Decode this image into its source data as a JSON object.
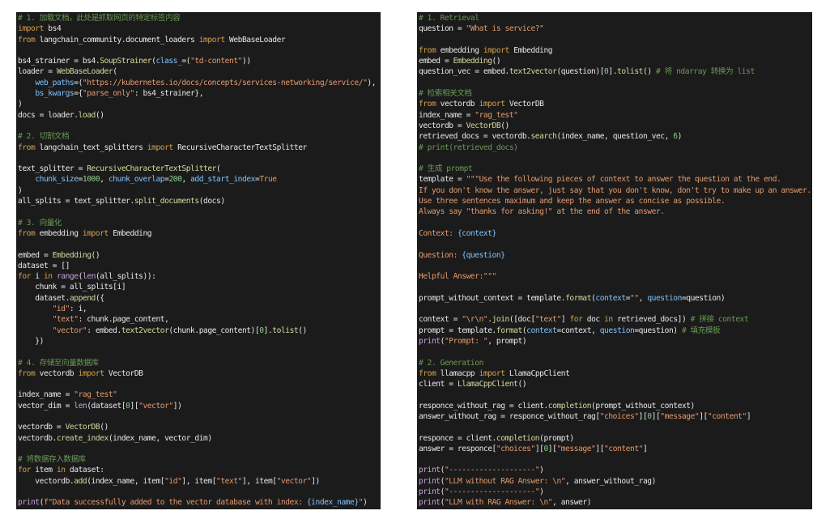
{
  "colors": {
    "background": "#ffffff",
    "editor_bg": "#1b1b1b",
    "comment": "#6a9955",
    "keyword": "#d5a04b",
    "string": "#e39b6e",
    "number": "#8fd08a",
    "function": "#d8d8a0",
    "builtin": "#c9a0dc",
    "param": "#7fc4ff",
    "text": "#dcdcdc"
  },
  "left_panel": {
    "lines": [
      [
        [
          "cm",
          "# 1. 加载文档，此处是抓取网页的特定标签内容"
        ]
      ],
      [
        [
          "kw",
          "import"
        ],
        [
          "id",
          " bs4"
        ]
      ],
      [
        [
          "kw",
          "from"
        ],
        [
          "id",
          " langchain_community.document_loaders "
        ],
        [
          "kw",
          "import"
        ],
        [
          "id",
          " WebBaseLoader"
        ]
      ],
      [],
      [
        [
          "id",
          "bs4_strainer = bs4."
        ],
        [
          "fn",
          "SoupStrainer"
        ],
        [
          "id",
          "("
        ],
        [
          "pm",
          "class_"
        ],
        [
          "id",
          "=("
        ],
        [
          "st",
          "\"td-content\""
        ],
        [
          "id",
          "))"
        ]
      ],
      [
        [
          "id",
          "loader = "
        ],
        [
          "fn",
          "WebBaseLoader"
        ],
        [
          "id",
          "("
        ]
      ],
      [
        [
          "id",
          "    "
        ],
        [
          "pm",
          "web_paths"
        ],
        [
          "id",
          "=("
        ],
        [
          "st",
          "\"https://kubernetes.io/docs/concepts/services-networking/service/\""
        ],
        [
          "id",
          "),"
        ]
      ],
      [
        [
          "id",
          "    "
        ],
        [
          "pm",
          "bs_kwargs"
        ],
        [
          "id",
          "={"
        ],
        [
          "st",
          "\"parse_only\""
        ],
        [
          "id",
          ": bs4_strainer},"
        ]
      ],
      [
        [
          "id",
          ")"
        ]
      ],
      [
        [
          "id",
          "docs = loader."
        ],
        [
          "fn",
          "load"
        ],
        [
          "id",
          "()"
        ]
      ],
      [],
      [
        [
          "cm",
          "# 2. 切割文档"
        ]
      ],
      [
        [
          "kw",
          "from"
        ],
        [
          "id",
          " langchain_text_splitters "
        ],
        [
          "kw",
          "import"
        ],
        [
          "id",
          " RecursiveCharacterTextSplitter"
        ]
      ],
      [],
      [
        [
          "id",
          "text_splitter = "
        ],
        [
          "fn",
          "RecursiveCharacterTextSplitter"
        ],
        [
          "id",
          "("
        ]
      ],
      [
        [
          "id",
          "    "
        ],
        [
          "pm",
          "chunk_size"
        ],
        [
          "id",
          "="
        ],
        [
          "nm",
          "1000"
        ],
        [
          "id",
          ", "
        ],
        [
          "pm",
          "chunk_overlap"
        ],
        [
          "id",
          "="
        ],
        [
          "nm",
          "200"
        ],
        [
          "id",
          ", "
        ],
        [
          "pm",
          "add_start_index"
        ],
        [
          "id",
          "="
        ],
        [
          "kw",
          "True"
        ]
      ],
      [
        [
          "id",
          ")"
        ]
      ],
      [
        [
          "id",
          "all_splits = text_splitter."
        ],
        [
          "fn",
          "split_documents"
        ],
        [
          "id",
          "(docs)"
        ]
      ],
      [],
      [
        [
          "cm",
          "# 3. 向量化"
        ]
      ],
      [
        [
          "kw",
          "from"
        ],
        [
          "id",
          " embedding "
        ],
        [
          "kw",
          "import"
        ],
        [
          "id",
          " Embedding"
        ]
      ],
      [],
      [
        [
          "id",
          "embed = "
        ],
        [
          "fn",
          "Embedding"
        ],
        [
          "id",
          "()"
        ]
      ],
      [
        [
          "id",
          "dataset = []"
        ]
      ],
      [
        [
          "kw",
          "for"
        ],
        [
          "id",
          " i "
        ],
        [
          "kw",
          "in"
        ],
        [
          "id",
          " "
        ],
        [
          "bi",
          "range"
        ],
        [
          "id",
          "("
        ],
        [
          "bi",
          "len"
        ],
        [
          "id",
          "(all_splits)):"
        ]
      ],
      [
        [
          "id",
          "    chunk = all_splits[i]"
        ]
      ],
      [
        [
          "id",
          "    dataset."
        ],
        [
          "fn",
          "append"
        ],
        [
          "id",
          "({"
        ]
      ],
      [
        [
          "id",
          "        "
        ],
        [
          "st",
          "\"id\""
        ],
        [
          "id",
          ": i,"
        ]
      ],
      [
        [
          "id",
          "        "
        ],
        [
          "st",
          "\"text\""
        ],
        [
          "id",
          ": chunk.page_content,"
        ]
      ],
      [
        [
          "id",
          "        "
        ],
        [
          "st",
          "\"vector\""
        ],
        [
          "id",
          ": embed."
        ],
        [
          "fn",
          "text2vector"
        ],
        [
          "id",
          "(chunk.page_content)["
        ],
        [
          "nm",
          "0"
        ],
        [
          "id",
          "]."
        ],
        [
          "fn",
          "tolist"
        ],
        [
          "id",
          "()"
        ]
      ],
      [
        [
          "id",
          "    })"
        ]
      ],
      [],
      [
        [
          "cm",
          "# 4. 存储至向量数据库"
        ]
      ],
      [
        [
          "kw",
          "from"
        ],
        [
          "id",
          " vectordb "
        ],
        [
          "kw",
          "import"
        ],
        [
          "id",
          " VectorDB"
        ]
      ],
      [],
      [
        [
          "id",
          "index_name = "
        ],
        [
          "st",
          "\"rag_test\""
        ]
      ],
      [
        [
          "id",
          "vector_dim = "
        ],
        [
          "bi",
          "len"
        ],
        [
          "id",
          "(dataset["
        ],
        [
          "nm",
          "0"
        ],
        [
          "id",
          "]["
        ],
        [
          "st",
          "\"vector\""
        ],
        [
          "id",
          "])"
        ]
      ],
      [],
      [
        [
          "id",
          "vectordb = "
        ],
        [
          "fn",
          "VectorDB"
        ],
        [
          "id",
          "()"
        ]
      ],
      [
        [
          "id",
          "vectordb."
        ],
        [
          "fn",
          "create_index"
        ],
        [
          "id",
          "(index_name, vector_dim)"
        ]
      ],
      [],
      [
        [
          "cm",
          "# 将数据存入数据库"
        ]
      ],
      [
        [
          "kw",
          "for"
        ],
        [
          "id",
          " item "
        ],
        [
          "kw",
          "in"
        ],
        [
          "id",
          " dataset:"
        ]
      ],
      [
        [
          "id",
          "    vectordb."
        ],
        [
          "fn",
          "add"
        ],
        [
          "id",
          "(index_name, item["
        ],
        [
          "st",
          "\"id\""
        ],
        [
          "id",
          "], item["
        ],
        [
          "st",
          "\"text\""
        ],
        [
          "id",
          "], item["
        ],
        [
          "st",
          "\"vector\""
        ],
        [
          "id",
          "])"
        ]
      ],
      [],
      [
        [
          "bi",
          "print"
        ],
        [
          "id",
          "("
        ],
        [
          "st",
          "f\"Data successfully added to the vector database with index: "
        ],
        [
          "pm",
          "{index_name}"
        ],
        [
          "st",
          "\""
        ],
        [
          "id",
          ")"
        ]
      ]
    ]
  },
  "right_panel": {
    "lines": [
      [
        [
          "cm",
          "# 1. Retrieval"
        ]
      ],
      [
        [
          "id",
          "question = "
        ],
        [
          "st",
          "\"What is service?\""
        ]
      ],
      [],
      [
        [
          "kw",
          "from"
        ],
        [
          "id",
          " embedding "
        ],
        [
          "kw",
          "import"
        ],
        [
          "id",
          " Embedding"
        ]
      ],
      [
        [
          "id",
          "embed = "
        ],
        [
          "fn",
          "Embedding"
        ],
        [
          "id",
          "()"
        ]
      ],
      [
        [
          "id",
          "question_vec = embed."
        ],
        [
          "fn",
          "text2vector"
        ],
        [
          "id",
          "(question)["
        ],
        [
          "nm",
          "0"
        ],
        [
          "id",
          "]."
        ],
        [
          "fn",
          "tolist"
        ],
        [
          "id",
          "() "
        ],
        [
          "cm",
          "# 将 ndarray 转换为 list"
        ]
      ],
      [],
      [
        [
          "cm",
          "# 检索相关文档"
        ]
      ],
      [
        [
          "kw",
          "from"
        ],
        [
          "id",
          " vectordb "
        ],
        [
          "kw",
          "import"
        ],
        [
          "id",
          " VectorDB"
        ]
      ],
      [
        [
          "id",
          "index_name = "
        ],
        [
          "st",
          "\"rag_test\""
        ]
      ],
      [
        [
          "id",
          "vectordb = "
        ],
        [
          "fn",
          "VectorDB"
        ],
        [
          "id",
          "()"
        ]
      ],
      [
        [
          "id",
          "retrieved_docs = vectordb."
        ],
        [
          "fn",
          "search"
        ],
        [
          "id",
          "(index_name, question_vec, "
        ],
        [
          "nm",
          "6"
        ],
        [
          "id",
          ")"
        ]
      ],
      [
        [
          "cm",
          "# print(retrieved_docs)"
        ]
      ],
      [],
      [
        [
          "cm",
          "# 生成 prompt"
        ]
      ],
      [
        [
          "id",
          "template = "
        ],
        [
          "st",
          "\"\"\"Use the following pieces of context to answer the question at the end."
        ]
      ],
      [
        [
          "st",
          "If you don't know the answer, just say that you don't know, don't try to make up an answer."
        ]
      ],
      [
        [
          "st",
          "Use three sentences maximum and keep the answer as concise as possible."
        ]
      ],
      [
        [
          "st",
          "Always say \"thanks for asking!\" at the end of the answer."
        ]
      ],
      [],
      [
        [
          "st",
          "Context: "
        ],
        [
          "pm",
          "{context}"
        ]
      ],
      [],
      [
        [
          "st",
          "Question: "
        ],
        [
          "pm",
          "{question}"
        ]
      ],
      [],
      [
        [
          "st",
          "Helpful Answer:\"\"\""
        ]
      ],
      [],
      [
        [
          "id",
          "prompt_without_context = template."
        ],
        [
          "fn",
          "format"
        ],
        [
          "id",
          "("
        ],
        [
          "pm",
          "context"
        ],
        [
          "id",
          "="
        ],
        [
          "st",
          "\"\""
        ],
        [
          "id",
          ", "
        ],
        [
          "pm",
          "question"
        ],
        [
          "id",
          "=question)"
        ]
      ],
      [],
      [
        [
          "id",
          "context = "
        ],
        [
          "st",
          "\"\\r\\n\""
        ],
        [
          "id",
          "."
        ],
        [
          "fn",
          "join"
        ],
        [
          "id",
          "([doc["
        ],
        [
          "st",
          "\"text\""
        ],
        [
          "id",
          "] "
        ],
        [
          "kw",
          "for"
        ],
        [
          "id",
          " doc "
        ],
        [
          "kw",
          "in"
        ],
        [
          "id",
          " retrieved_docs]) "
        ],
        [
          "cm",
          "# 拼接 context"
        ]
      ],
      [
        [
          "id",
          "prompt = template."
        ],
        [
          "fn",
          "format"
        ],
        [
          "id",
          "("
        ],
        [
          "pm",
          "context"
        ],
        [
          "id",
          "=context, "
        ],
        [
          "pm",
          "question"
        ],
        [
          "id",
          "=question) "
        ],
        [
          "cm",
          "# 填充模板"
        ]
      ],
      [
        [
          "bi",
          "print"
        ],
        [
          "id",
          "("
        ],
        [
          "st",
          "\"Prompt: \""
        ],
        [
          "id",
          ", prompt)"
        ]
      ],
      [],
      [
        [
          "cm",
          "# 2. Generation"
        ]
      ],
      [
        [
          "kw",
          "from"
        ],
        [
          "id",
          " llamacpp "
        ],
        [
          "kw",
          "import"
        ],
        [
          "id",
          " LlamaCppClient"
        ]
      ],
      [
        [
          "id",
          "client = "
        ],
        [
          "fn",
          "LlamaCppClient"
        ],
        [
          "id",
          "()"
        ]
      ],
      [],
      [
        [
          "id",
          "responce_without_rag = client."
        ],
        [
          "fn",
          "completion"
        ],
        [
          "id",
          "(prompt_without_context)"
        ]
      ],
      [
        [
          "id",
          "answer_without_rag = responce_without_rag["
        ],
        [
          "st",
          "\"choices\""
        ],
        [
          "id",
          "]["
        ],
        [
          "nm",
          "0"
        ],
        [
          "id",
          "]["
        ],
        [
          "st",
          "\"message\""
        ],
        [
          "id",
          "]["
        ],
        [
          "st",
          "\"content\""
        ],
        [
          "id",
          "]"
        ]
      ],
      [],
      [
        [
          "id",
          "responce = client."
        ],
        [
          "fn",
          "completion"
        ],
        [
          "id",
          "(prompt)"
        ]
      ],
      [
        [
          "id",
          "answer = responce["
        ],
        [
          "st",
          "\"choices\""
        ],
        [
          "id",
          "]["
        ],
        [
          "nm",
          "0"
        ],
        [
          "id",
          "]["
        ],
        [
          "st",
          "\"message\""
        ],
        [
          "id",
          "]["
        ],
        [
          "st",
          "\"content\""
        ],
        [
          "id",
          "]"
        ]
      ],
      [],
      [
        [
          "bi",
          "print"
        ],
        [
          "id",
          "("
        ],
        [
          "st",
          "\"--------------------\""
        ],
        [
          "id",
          ")"
        ]
      ],
      [
        [
          "bi",
          "print"
        ],
        [
          "id",
          "("
        ],
        [
          "st",
          "\"LLM without RAG Answer: \\n\""
        ],
        [
          "id",
          ", answer_without_rag)"
        ]
      ],
      [
        [
          "bi",
          "print"
        ],
        [
          "id",
          "("
        ],
        [
          "st",
          "\"--------------------\""
        ],
        [
          "id",
          ")"
        ]
      ],
      [
        [
          "bi",
          "print"
        ],
        [
          "id",
          "("
        ],
        [
          "st",
          "\"LLM with RAG Answer: \\n\""
        ],
        [
          "id",
          ", answer)"
        ]
      ]
    ]
  }
}
